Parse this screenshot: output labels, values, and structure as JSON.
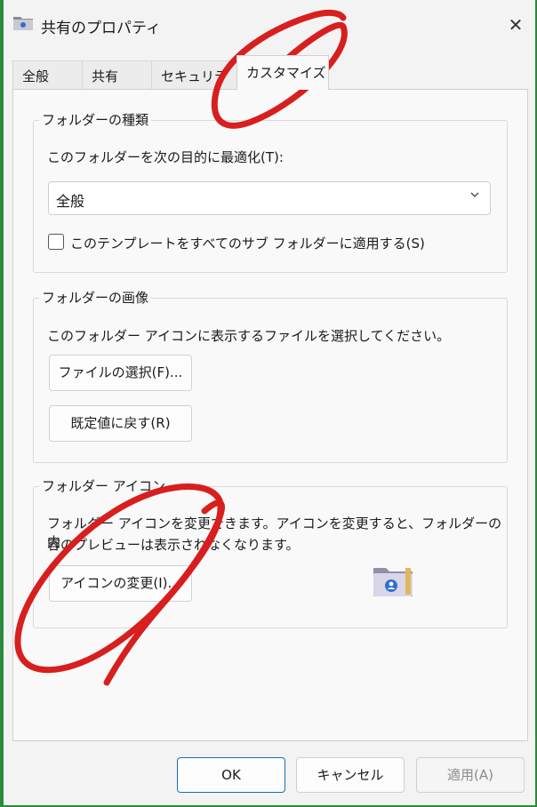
{
  "window": {
    "title": "共有のプロパティ",
    "close_symbol": "✕"
  },
  "tabs": [
    {
      "label": "全般",
      "active": false
    },
    {
      "label": "共有",
      "active": false
    },
    {
      "label": "セキュリティ",
      "active": false
    },
    {
      "label": "カスタマイズ",
      "active": true
    }
  ],
  "folder_type": {
    "group_title": "フォルダーの種類",
    "optimize_label": "このフォルダーを次の目的に最適化(T):",
    "optimize_value": "全般",
    "apply_template_label": "このテンプレートをすべてのサブ フォルダーに適用する(S)",
    "apply_template_checked": false
  },
  "folder_picture": {
    "group_title": "フォルダーの画像",
    "description": "このフォルダー アイコンに表示するファイルを選択してください。",
    "choose_file_button": "ファイルの選択(F)...",
    "restore_default_button": "既定値に戻す(R)"
  },
  "folder_icon": {
    "group_title": "フォルダー アイコン",
    "description_line1": "フォルダー アイコンを変更できます。アイコンを変更すると、フォルダーの内",
    "description_line2": "容のプレビューは表示されなくなります。",
    "change_icon_button": "アイコンの変更(I)..."
  },
  "footer": {
    "ok": "OK",
    "cancel": "キャンセル",
    "apply": "適用(A)",
    "apply_enabled": false
  },
  "colors": {
    "desktop_background": "#2c8a3c",
    "dialog_background": "#f3f3f3",
    "annotation_red": "#d81e1e",
    "primary_border": "#1a6fb5"
  }
}
